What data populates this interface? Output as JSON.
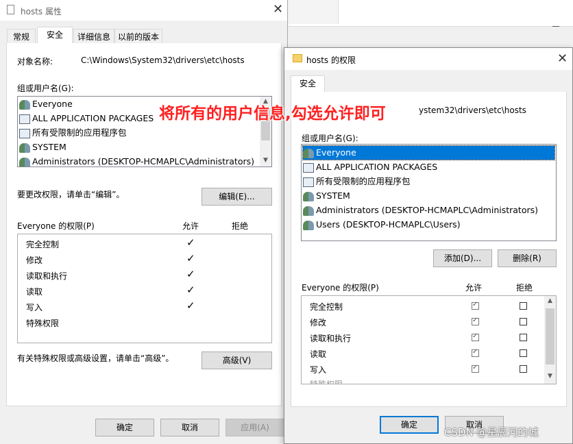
{
  "back_window": {
    "title": "hosts 属性",
    "tabs": [
      "常规",
      "安全",
      "详细信息",
      "以前的版本"
    ],
    "object_label": "对象名称:",
    "object_path": "C:\\Windows\\System32\\drivers\\etc\\hosts",
    "group_label": "组或用户名(G):",
    "users": [
      "Everyone",
      "ALL APPLICATION PACKAGES",
      "所有受限制的应用程序包",
      "SYSTEM",
      "Administrators (DESKTOP-HCMAPLC\\Administrators)"
    ],
    "edit_hint": "要更改权限，请单击“编辑”。",
    "edit_button": "编辑(E)...",
    "perm_title": "Everyone 的权限(P)",
    "allow": "允许",
    "deny": "拒绝",
    "permissions": [
      {
        "name": "完全控制",
        "allow": true
      },
      {
        "name": "修改",
        "allow": true
      },
      {
        "name": "读取和执行",
        "allow": true
      },
      {
        "name": "读取",
        "allow": true
      },
      {
        "name": "写入",
        "allow": true
      },
      {
        "name": "特殊权限",
        "allow": false
      }
    ],
    "advanced_hint": "有关特殊权限或高级设置，请单击“高级”。",
    "advanced_button": "高级(V)",
    "ok": "确定",
    "cancel": "取消",
    "apply": "应用(A)"
  },
  "front_window": {
    "title": "hosts 的权限",
    "tab": "安全",
    "object_partial": "ystem32\\drivers\\etc\\hosts",
    "group_label": "组或用户名(G):",
    "users": [
      "Everyone",
      "ALL APPLICATION PACKAGES",
      "所有受限制的应用程序包",
      "SYSTEM",
      "Administrators (DESKTOP-HCMAPLC\\Administrators)",
      "Users (DESKTOP-HCMAPLC\\Users)"
    ],
    "add_button": "添加(D)...",
    "remove_button": "删除(R)",
    "perm_title": "Everyone 的权限(P)",
    "allow": "允许",
    "deny": "拒绝",
    "permissions": [
      "完全控制",
      "修改",
      "读取和执行",
      "读取",
      "写入",
      "特殊权限"
    ],
    "ok": "确定",
    "cancel_partial": "取消"
  },
  "annotation": "将所有的用户信息,勾选允许即可",
  "watermark": "CSDN @星辰河的城",
  "colors": {
    "selection": "#0078d7",
    "annotation": "#ff2020"
  }
}
